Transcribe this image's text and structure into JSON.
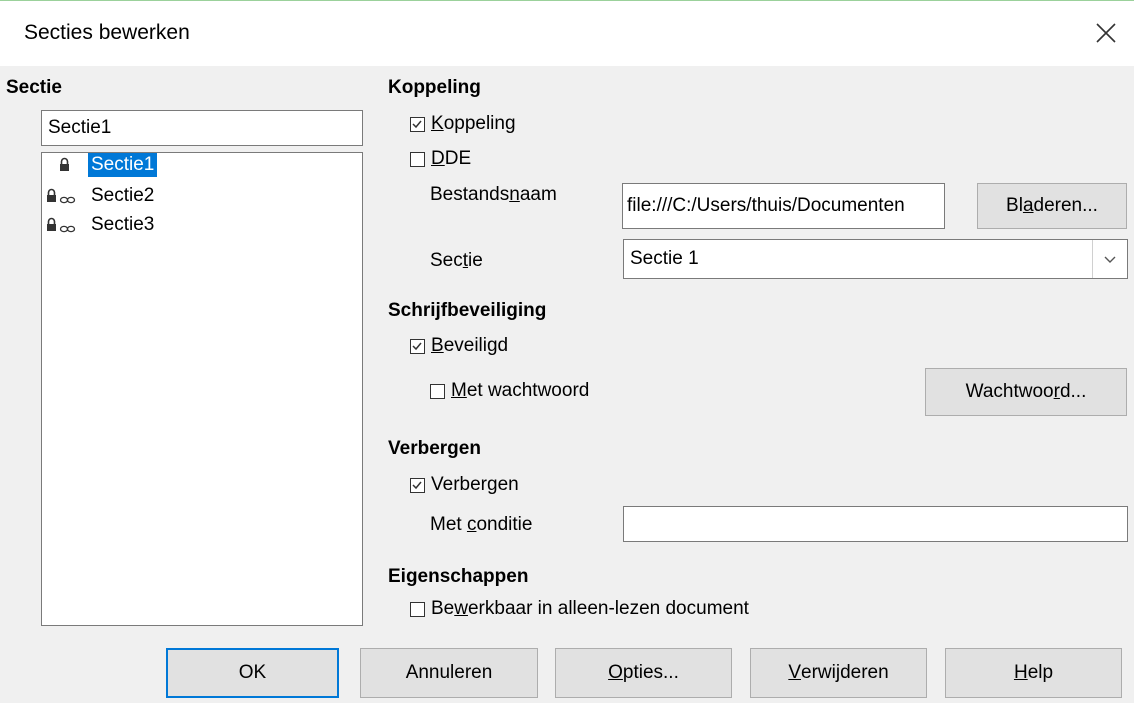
{
  "dialog": {
    "title": "Secties bewerken"
  },
  "left": {
    "heading": "Sectie",
    "name_value": "Sectie1",
    "tree": [
      {
        "label": "Sectie1",
        "icon": "lock-icon",
        "selected": true
      },
      {
        "label": "Sectie2",
        "icon": "lock-link-icon",
        "selected": false
      },
      {
        "label": "Sectie3",
        "icon": "lock-link-icon",
        "selected": false
      }
    ]
  },
  "link": {
    "heading": "Koppeling",
    "link_check": {
      "pre": "",
      "u": "K",
      "post": "oppeling",
      "checked": true
    },
    "dde_check": {
      "pre": "",
      "u": "D",
      "post": "DE",
      "checked": false
    },
    "filename_label": {
      "pre": "Bestands",
      "u": "n",
      "post": "aam"
    },
    "filename_value": "file:///C:/Users/thuis/Documenten",
    "browse_button": {
      "pre": "Bl",
      "u": "a",
      "post": "deren..."
    },
    "section_label": {
      "pre": "Sec",
      "u": "t",
      "post": "ie"
    },
    "section_value": "Sectie 1"
  },
  "protect": {
    "heading": "Schrijfbeveiliging",
    "protected_check": {
      "pre": "",
      "u": "B",
      "post": "eveiligd",
      "checked": true
    },
    "password_check": {
      "pre": "",
      "u": "M",
      "post": "et wachtwoord",
      "checked": false
    },
    "password_button": {
      "pre": "Wachtwoo",
      "u": "r",
      "post": "d..."
    }
  },
  "hide": {
    "heading": "Verbergen",
    "hide_check": {
      "pre": "Verber",
      "u": "g",
      "post": "en",
      "checked": true
    },
    "condition_label": {
      "pre": "Met ",
      "u": "c",
      "post": "onditie"
    },
    "condition_value": ""
  },
  "properties": {
    "heading": "Eigenschappen",
    "editable_check": {
      "pre": "Be",
      "u": "w",
      "post": "erkbaar in alleen-lezen document",
      "checked": false
    }
  },
  "buttons": {
    "ok": {
      "pre": "OK",
      "u": "",
      "post": ""
    },
    "cancel": {
      "pre": "Annuleren",
      "u": "",
      "post": ""
    },
    "options": {
      "pre": "",
      "u": "O",
      "post": "pties..."
    },
    "remove": {
      "pre": "",
      "u": "V",
      "post": "erwijderen"
    },
    "help": {
      "pre": "",
      "u": "H",
      "post": "elp"
    }
  },
  "colors": {
    "accent": "#0078d7",
    "dialog_bg": "#f0f0f0"
  }
}
